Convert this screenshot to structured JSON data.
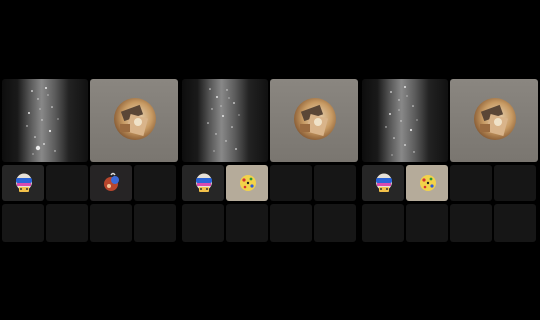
{
  "panels": [
    {
      "id": "panel-1",
      "tiles": [
        {
          "kind": "video",
          "icon": "sparkle-video"
        },
        {
          "kind": "avatar",
          "icon": "profile-avatar"
        },
        {
          "kind": "avatar-small",
          "icon": "skull-sunglasses-avatar"
        },
        {
          "kind": "empty"
        },
        {
          "kind": "avatar-small",
          "icon": "mixed-avatar"
        },
        {
          "kind": "empty"
        }
      ]
    },
    {
      "id": "panel-2",
      "tiles": [
        {
          "kind": "video",
          "icon": "sparkle-video"
        },
        {
          "kind": "avatar",
          "icon": "profile-avatar"
        },
        {
          "kind": "avatar-small",
          "icon": "skull-sunglasses-avatar"
        },
        {
          "kind": "avatar-small",
          "icon": "dice-avatar"
        },
        {
          "kind": "empty"
        },
        {
          "kind": "empty"
        }
      ]
    },
    {
      "id": "panel-3",
      "tiles": [
        {
          "kind": "video",
          "icon": "sparkle-video"
        },
        {
          "kind": "avatar",
          "icon": "profile-avatar"
        },
        {
          "kind": "avatar-small",
          "icon": "skull-sunglasses-avatar"
        },
        {
          "kind": "avatar-small",
          "icon": "dice-avatar"
        },
        {
          "kind": "empty"
        },
        {
          "kind": "empty"
        }
      ]
    }
  ],
  "colors": {
    "background": "#000000",
    "tile": "#161616",
    "bigtile": "#8a8680",
    "beige": "#b5ab9a"
  }
}
